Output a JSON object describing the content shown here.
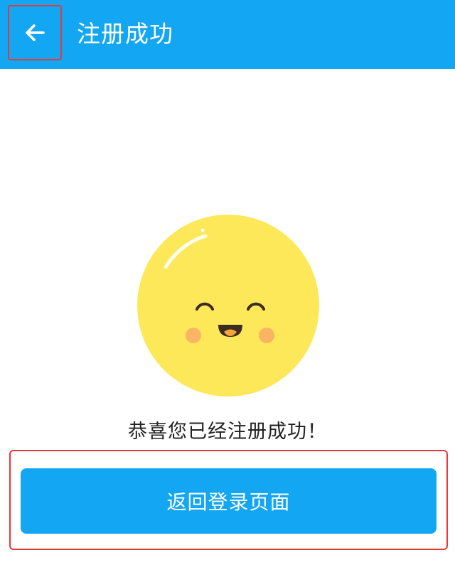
{
  "app_bar": {
    "title": "注册成功",
    "back_icon": "arrow-left-icon",
    "background_color": "#13a6f2"
  },
  "illustration": {
    "icon": "smiley-face-icon",
    "face_color": "#fde85a",
    "cheek_color": "#f9b563",
    "mouth_color": "#3b2c22",
    "tongue_color": "#f7a23a"
  },
  "main": {
    "message": "恭喜您已经注册成功！",
    "primary_button_label": "返回登录页面",
    "button_color": "#13a6f2"
  },
  "annotations": {
    "highlight_color": "#e53935"
  }
}
